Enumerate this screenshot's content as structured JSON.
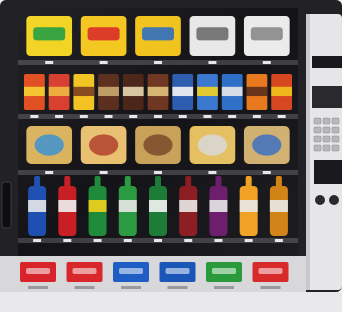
{
  "scene": {
    "description_free": true,
    "palette": {
      "cabinet": "#222226",
      "interior": "#141418",
      "shelf": "#3d3d42",
      "panel": "#e6e6e8",
      "panel_shadow": "#c9c9cc",
      "base": "#d8d8da"
    },
    "shelves": [
      {
        "row": "chips-top",
        "items": [
          {
            "color": "#f2d21c",
            "accent": "#1c9a3c",
            "kind": "bag"
          },
          {
            "color": "#f5c51a",
            "accent": "#d8261f",
            "kind": "bag"
          },
          {
            "color": "#f1c219",
            "accent": "#2a6bc0",
            "kind": "bag"
          },
          {
            "color": "#e8e8e8",
            "accent": "#6a6a6a",
            "kind": "bag"
          },
          {
            "color": "#ebebeb",
            "accent": "#8a8a8a",
            "kind": "bag"
          }
        ]
      },
      {
        "row": "candy",
        "items": [
          {
            "color": "#e04a1c",
            "accent": "#f6d02a",
            "kind": "bar"
          },
          {
            "color": "#d73a2a",
            "accent": "#f0b73a",
            "kind": "bar"
          },
          {
            "color": "#f3c21f",
            "accent": "#7a3a1a",
            "kind": "bar"
          },
          {
            "color": "#5a2b1a",
            "accent": "#c9a86b",
            "kind": "bar"
          },
          {
            "color": "#4a2416",
            "accent": "#e8d6b0",
            "kind": "bar"
          },
          {
            "color": "#6e3520",
            "accent": "#e0c27a",
            "kind": "bar"
          },
          {
            "color": "#2c5db0",
            "accent": "#f4f4f4",
            "kind": "bar"
          },
          {
            "color": "#3a78d0",
            "accent": "#f4d21f",
            "kind": "bar"
          },
          {
            "color": "#2e6fc8",
            "accent": "#e8e8e8",
            "kind": "bar"
          },
          {
            "color": "#e8781c",
            "accent": "#5a2b1a",
            "kind": "bar"
          },
          {
            "color": "#d6451e",
            "accent": "#f1c219",
            "kind": "bar"
          }
        ]
      },
      {
        "row": "snacks",
        "items": [
          {
            "color": "#d9b25c",
            "accent": "#3a8fd0",
            "kind": "tray"
          },
          {
            "color": "#e9c070",
            "accent": "#b0402a",
            "kind": "tray"
          },
          {
            "color": "#c9a25a",
            "accent": "#7a4a2a",
            "kind": "tray"
          },
          {
            "color": "#e4c060",
            "accent": "#d8d8d8",
            "kind": "tray"
          },
          {
            "color": "#d0b070",
            "accent": "#3a6fc0",
            "kind": "tray"
          }
        ]
      },
      {
        "row": "bottles",
        "items": [
          {
            "color": "#1c4fb0",
            "accent": "#e8e8e8",
            "kind": "bottle"
          },
          {
            "color": "#c81e24",
            "accent": "#f0f0f0",
            "kind": "bottle"
          },
          {
            "color": "#1f8a3a",
            "accent": "#f2d21c",
            "kind": "bottle"
          },
          {
            "color": "#2a9a40",
            "accent": "#e8e8e8",
            "kind": "bottle"
          },
          {
            "color": "#1a7a35",
            "accent": "#f4f4f4",
            "kind": "bottle"
          },
          {
            "color": "#8a1a20",
            "accent": "#e8e8e8",
            "kind": "bottle"
          },
          {
            "color": "#6a1a6a",
            "accent": "#e8e8e8",
            "kind": "bottle"
          },
          {
            "color": "#f0a020",
            "accent": "#e8e8e8",
            "kind": "bottle"
          },
          {
            "color": "#d08010",
            "accent": "#e8e8e8",
            "kind": "bottle"
          }
        ]
      }
    ],
    "selection_buttons": [
      {
        "color": "#d6242a"
      },
      {
        "color": "#d8282c"
      },
      {
        "color": "#1e5ec4"
      },
      {
        "color": "#1a55b8"
      },
      {
        "color": "#2a9a3c"
      },
      {
        "color": "#d82a2a"
      }
    ]
  }
}
